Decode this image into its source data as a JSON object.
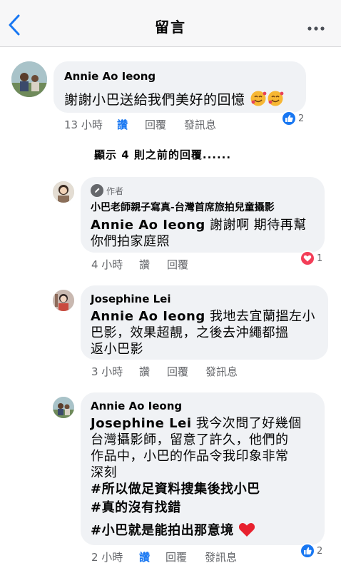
{
  "header": {
    "title": "留言",
    "back_icon": "chevron-left-icon",
    "more_icon": "more-horizontal-icon"
  },
  "colors": {
    "link_blue": "#1877f2",
    "bubble_bg": "#f0f2f5",
    "meta_gray": "#65676b",
    "love_red": "#f33e58"
  },
  "show_more": "顯示 4 則之前的回覆......",
  "comments": [
    {
      "author": "Annie Ao Ieong",
      "text": "謝謝小巴送給我們美好的回憶",
      "emoji": "smiling-face-with-hearts x2",
      "time": "13 小時",
      "like": "讚",
      "reply": "回覆",
      "message": "發訊息",
      "reaction": {
        "type": "like",
        "count": "2"
      }
    },
    {
      "badge": "作者",
      "author": "小巴老師親子寫真-台灣首席旅拍兒童攝影",
      "mention": "Annie Ao Ieong",
      "text_line1": "謝謝啊 期待再幫",
      "text_line2": "你們拍家庭照",
      "time": "4 小時",
      "like": "讚",
      "reply": "回覆",
      "reaction": {
        "type": "love",
        "count": "1"
      }
    },
    {
      "author": "Josephine Lei",
      "mention": "Annie Ao Ieong",
      "text_line1": "我地去宜蘭搵左小",
      "text_line2": "巴影，效果超靚，之後去沖繩都搵",
      "text_line3": "返小巴影",
      "time": "3 小時",
      "like": "讚",
      "reply": "回覆",
      "message": "發訊息"
    },
    {
      "author": "Annie Ao Ieong",
      "mention": "Josephine Lei",
      "text_line1": "我今次問了好幾個",
      "text_line2": "台灣攝影師，留意了許久，他們的",
      "text_line3": "作品中，小巴的作品令我印象非常",
      "text_line4": "深刻",
      "hashtag1": "#所以做足資料搜集後找小巴",
      "hashtag2": "#真的沒有找錯",
      "hashtag3": "#小巴就是能拍出那意境",
      "emoji": "red-heart",
      "time": "2 小時",
      "like": "讚",
      "reply": "回覆",
      "message": "發訊息",
      "reaction": {
        "type": "like",
        "count": "2"
      }
    }
  ]
}
